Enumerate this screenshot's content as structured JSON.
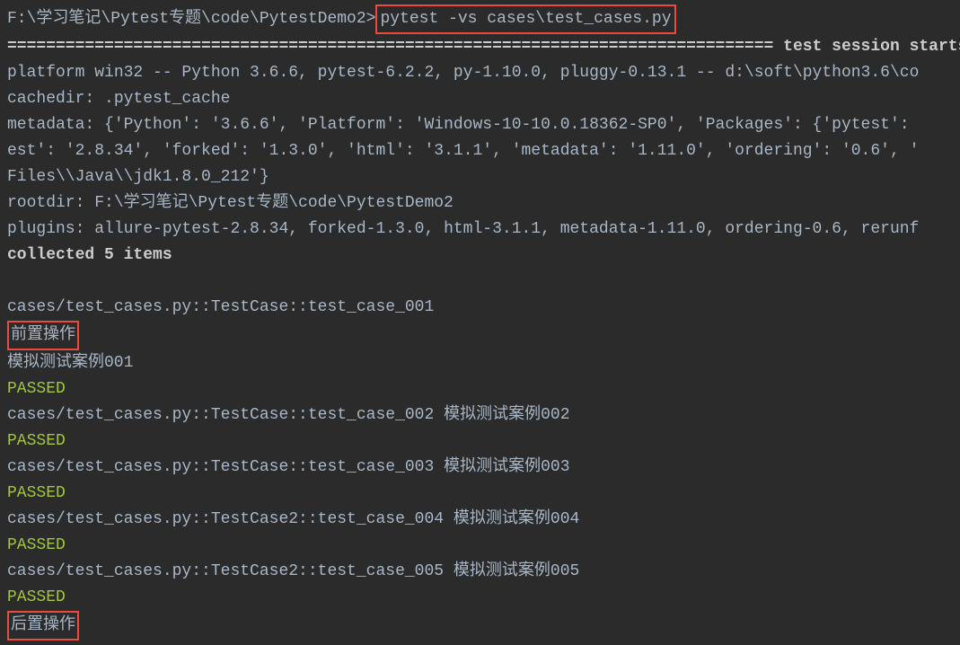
{
  "prompt_path": "F:\\学习笔记\\Pytest专题\\code\\PytestDemo2>",
  "command": "pytest -vs cases\\test_cases.py",
  "session_header_pre": "=============================================================================== ",
  "session_header_text": "test session starts",
  "session_header_post": " ===",
  "platform_line": "platform win32 -- Python 3.6.6, pytest-6.2.2, py-1.10.0, pluggy-0.13.1 -- d:\\soft\\python3.6\\co",
  "cachedir_line": "cachedir: .pytest_cache",
  "metadata_line1": "metadata: {'Python': '3.6.6', 'Platform': 'Windows-10-10.0.18362-SP0', 'Packages': {'pytest': ",
  "metadata_line2": "est': '2.8.34', 'forked': '1.3.0', 'html': '3.1.1', 'metadata': '1.11.0', 'ordering': '0.6', '",
  "metadata_line3": " Files\\\\Java\\\\jdk1.8.0_212'}",
  "rootdir_line": "rootdir: F:\\学习笔记\\Pytest专题\\code\\PytestDemo2",
  "plugins_line": "plugins: allure-pytest-2.8.34, forked-1.3.0, html-3.1.1, metadata-1.11.0, ordering-0.6, rerunf",
  "collected_line": "collected 5 items",
  "test1_id": "cases/test_cases.py::TestCase::test_case_001 ",
  "setup_text": "前置操作",
  "test1_output": "模拟测试案例001",
  "passed": "PASSED",
  "test2_id": "cases/test_cases.py::TestCase::test_case_002 ",
  "test2_output": "模拟测试案例002",
  "test3_id": "cases/test_cases.py::TestCase::test_case_003 ",
  "test3_output": "模拟测试案例003",
  "test4_id": "cases/test_cases.py::TestCase2::test_case_004 ",
  "test4_output": "模拟测试案例004",
  "test5_id": "cases/test_cases.py::TestCase2::test_case_005 ",
  "test5_output": "模拟测试案例005",
  "teardown_text": "后置操作"
}
